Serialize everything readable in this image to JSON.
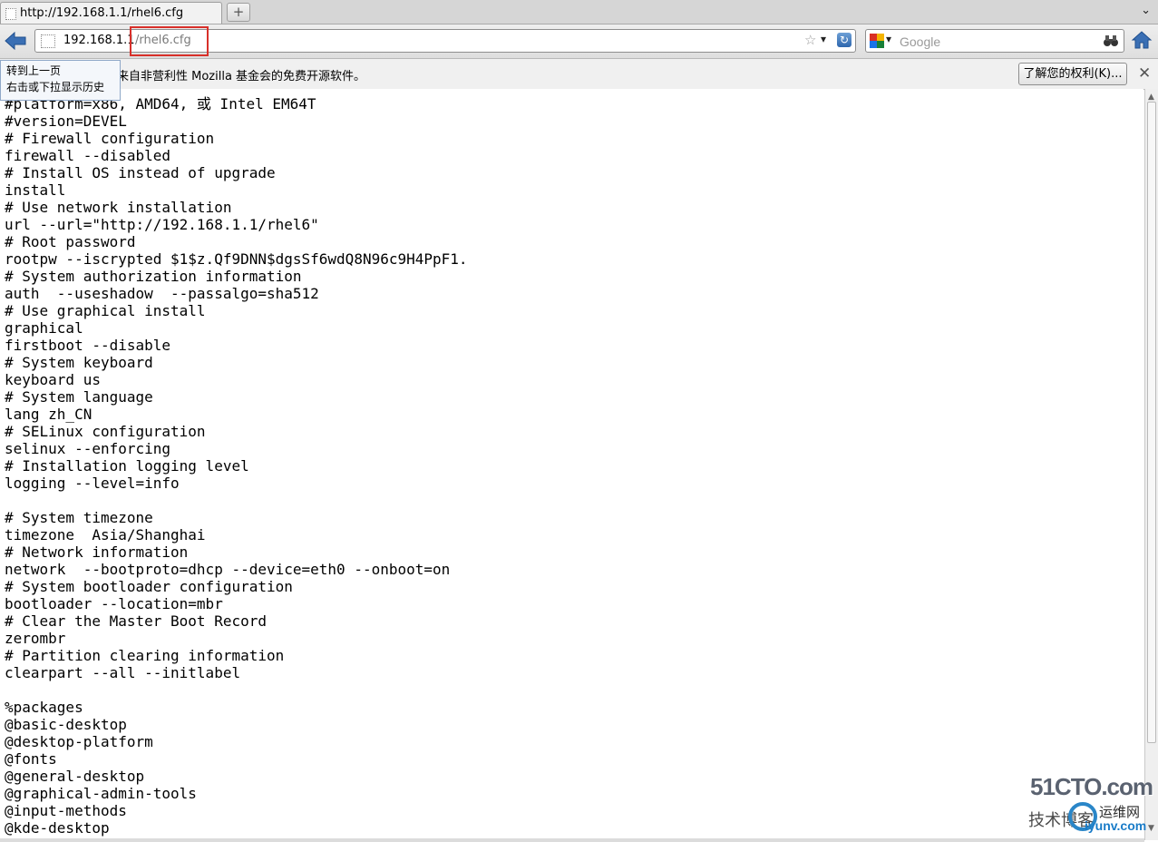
{
  "tab": {
    "title": "http://192.168.1.1/rhel6.cfg"
  },
  "urlbar": {
    "host": "192.168.1.1",
    "path": "/rhel6.cfg"
  },
  "search": {
    "placeholder": "Google"
  },
  "notification": {
    "message": "是来自非营利性 Mozilla 基金会的免费开源软件。",
    "rights_button": "了解您的权利(K)..."
  },
  "tooltip": {
    "line1": "转到上一页",
    "line2": "右击或下拉显示历史"
  },
  "document": {
    "text": "#platform=x86, AMD64, 或 Intel EM64T\n#version=DEVEL\n# Firewall configuration\nfirewall --disabled\n# Install OS instead of upgrade\ninstall\n# Use network installation\nurl --url=\"http://192.168.1.1/rhel6\"\n# Root password\nrootpw --iscrypted $1$z.Qf9DNN$dgsSf6wdQ8N96c9H4PpF1.\n# System authorization information\nauth  --useshadow  --passalgo=sha512\n# Use graphical install\ngraphical\nfirstboot --disable\n# System keyboard\nkeyboard us\n# System language\nlang zh_CN\n# SELinux configuration\nselinux --enforcing\n# Installation logging level\nlogging --level=info\n\n# System timezone\ntimezone  Asia/Shanghai\n# Network information\nnetwork  --bootproto=dhcp --device=eth0 --onboot=on\n# System bootloader configuration\nbootloader --location=mbr\n# Clear the Master Boot Record\nzerombr\n# Partition clearing information\nclearpart --all --initlabel\n\n%packages\n@basic-desktop\n@desktop-platform\n@fonts\n@general-desktop\n@graphical-admin-tools\n@input-methods\n@kde-desktop"
  },
  "watermark": {
    "brand": "51CTO.com",
    "left": "技术博客",
    "right": "运维网",
    "domain": "iyunv.com"
  },
  "colors": {
    "highlight_box": "#d8302a",
    "watermark_blue": "#1a7cc8"
  }
}
